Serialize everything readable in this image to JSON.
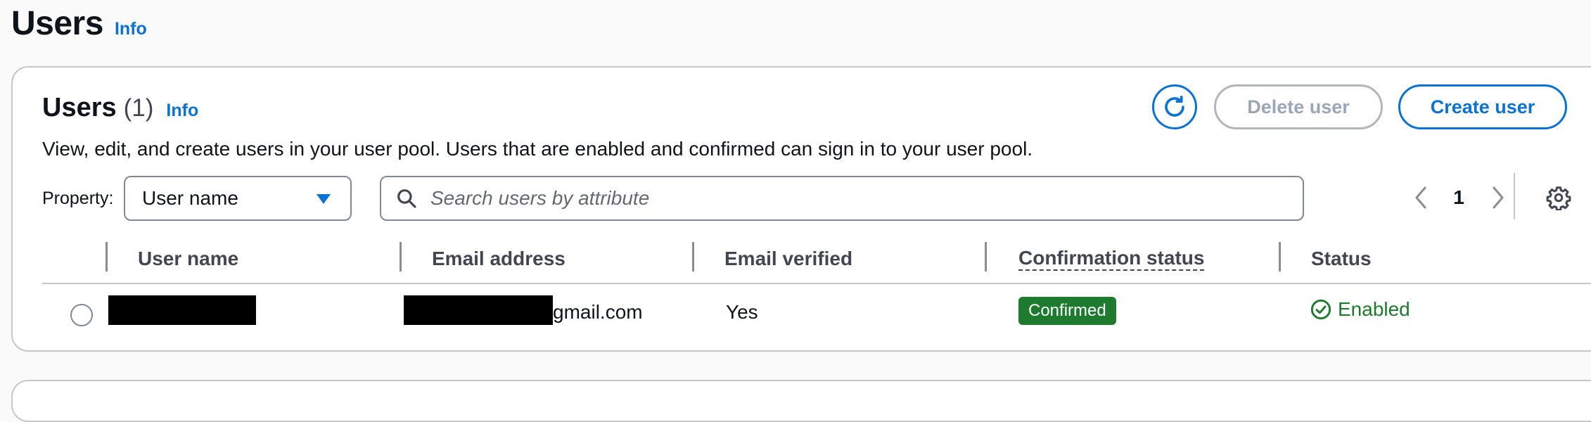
{
  "page": {
    "title": "Users",
    "info": "Info"
  },
  "panel": {
    "title": "Users",
    "count": "(1)",
    "info": "Info",
    "description": "View, edit, and create users in your user pool. Users that are enabled and confirmed can sign in to your user pool."
  },
  "actions": {
    "delete": "Delete user",
    "create": "Create user"
  },
  "filter": {
    "property_label": "Property:",
    "property_value": "User name",
    "search_placeholder": "Search users by attribute"
  },
  "pagination": {
    "current": "1"
  },
  "table": {
    "columns": [
      "User name",
      "Email address",
      "Email verified",
      "Confirmation status",
      "Status"
    ],
    "rows": [
      {
        "email_suffix": "gmail.com",
        "email_verified": "Yes",
        "confirmation_status": "Confirmed",
        "status": "Enabled"
      }
    ]
  },
  "colors": {
    "accent": "#0972d3",
    "success": "#1e7a2e",
    "disabled": "#9ba7b6"
  },
  "icons": [
    "refresh-icon",
    "caret-down-icon",
    "search-icon",
    "chevron-left-icon",
    "chevron-right-icon",
    "gear-icon",
    "check-circle-icon"
  ]
}
